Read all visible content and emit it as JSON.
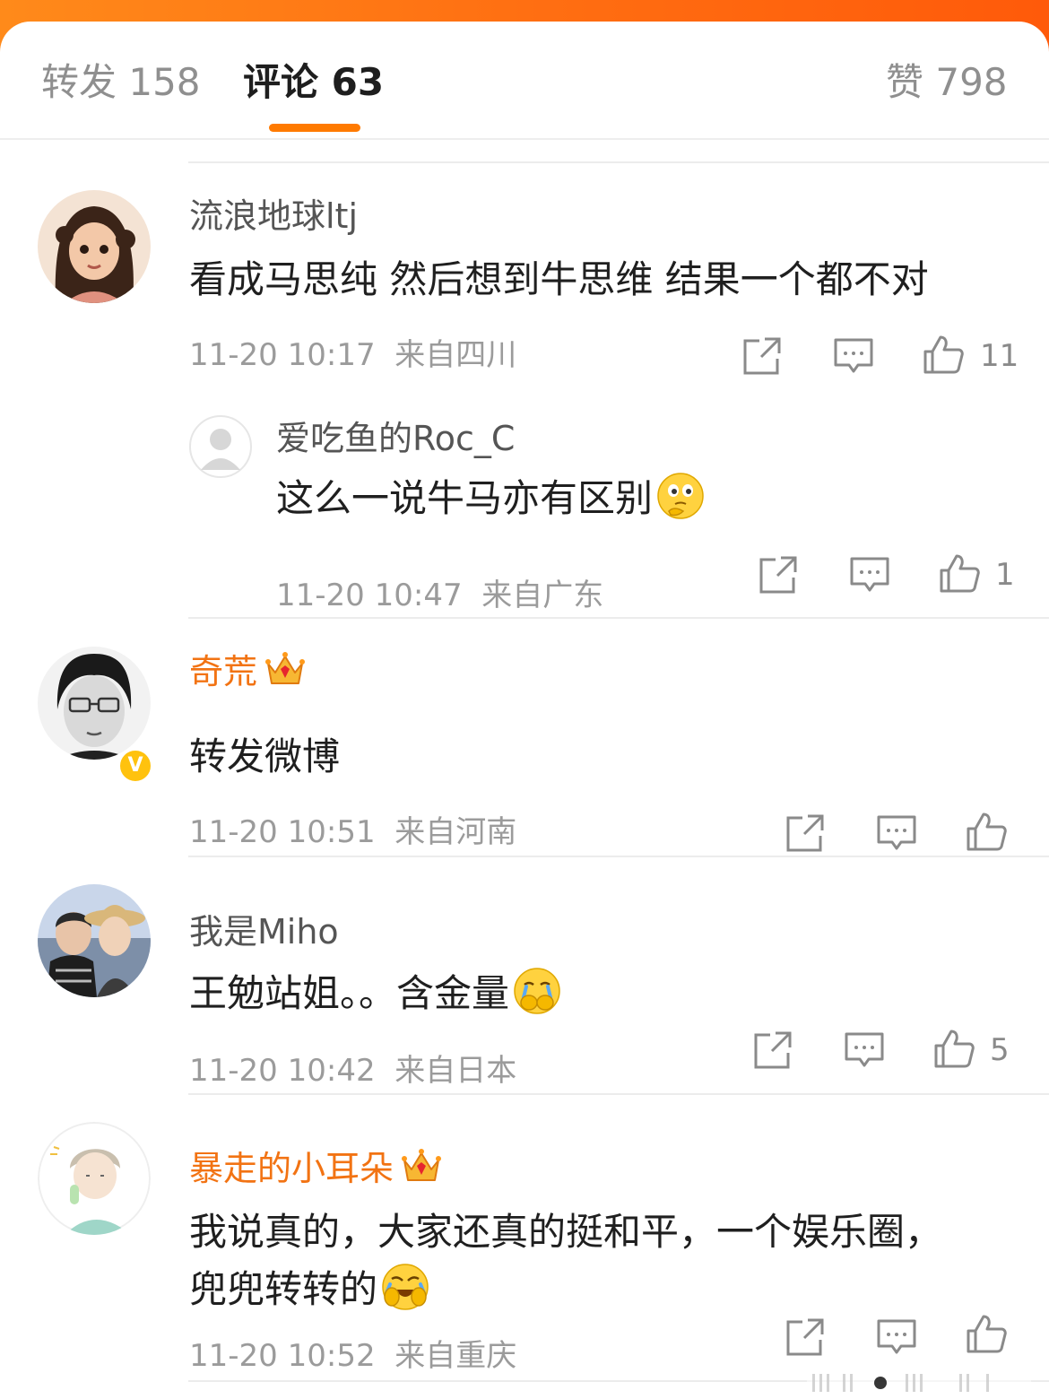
{
  "tabs": {
    "repost": "转发 158",
    "comment": "评论 63",
    "like": "赞 798"
  },
  "comments": [
    {
      "username": "流浪地球ltj",
      "text": "看成马思纯 然后想到牛思维  结果一个都不对",
      "time": "11-20 10:17",
      "location": "来自四川",
      "likes": "11",
      "reply": {
        "username": "爱吃鱼的Roc_C",
        "text": "这么一说牛马亦有区别",
        "emoji": "thinking-face",
        "time": "11-20 10:47",
        "location": "来自广东",
        "likes": "1"
      }
    },
    {
      "username": "奇荒",
      "verified": "V",
      "text": "转发微博",
      "time": "11-20 10:51",
      "location": "来自河南",
      "likes": ""
    },
    {
      "username": "我是Miho",
      "text": "王勉站姐。。含金量",
      "emoji": "crying-covering-mouth",
      "time": "11-20 10:42",
      "location": "来自日本",
      "likes": "5"
    },
    {
      "username": "暴走的小耳朵",
      "text_line1": "我说真的，大家还真的挺和平，一个娱乐圈，",
      "text_line2": "兜兜转转的",
      "emoji": "laughing-covering-face",
      "time": "11-20 10:52",
      "location": "来自重庆",
      "likes": ""
    }
  ],
  "colors": {
    "accent": "#ff7a00",
    "vip_name": "#f27313",
    "meta": "#9b9b9b"
  }
}
